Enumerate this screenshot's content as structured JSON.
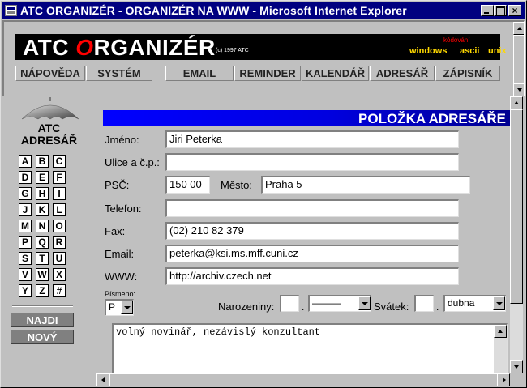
{
  "window": {
    "title": "ATC ORGANIZÉR - ORGANIZÉR NA WWW - Microsoft Internet Explorer",
    "close_glyph": "×"
  },
  "banner": {
    "title_prefix": "ATC ",
    "title_red": "O",
    "title_suffix": "RGANIZÉR",
    "copyright": "(c) 1997 ATC",
    "encoding_label": "kódování",
    "encodings": [
      "windows",
      "ascii",
      "unix"
    ]
  },
  "nav": [
    "NÁPOVĚDA",
    "SYSTÉM",
    "EMAIL",
    "REMINDER",
    "KALENDÁŘ",
    "ADRESÁŘ",
    "ZÁPISNÍK"
  ],
  "sidebar": {
    "logo_line1": "ATC",
    "logo_line2": "ADRESÁŘ",
    "letters": [
      "A",
      "B",
      "C",
      "D",
      "E",
      "F",
      "G",
      "H",
      "I",
      "J",
      "K",
      "L",
      "M",
      "N",
      "O",
      "P",
      "Q",
      "R",
      "S",
      "T",
      "U",
      "V",
      "W",
      "X",
      "Y",
      "Z",
      "#"
    ],
    "search_button": "NAJDI",
    "new_button": "NOVÝ"
  },
  "form": {
    "header": "POLOŽKA ADRESÁŘE",
    "labels": {
      "name": "Jméno:",
      "street": "Ulice a č.p.:",
      "zip": "PSČ:",
      "city": "Město:",
      "phone": "Telefon:",
      "fax": "Fax:",
      "email": "Email:",
      "www": "WWW:",
      "letter": "Písmeno:",
      "birthday": "Narozeniny:",
      "nameday": "Svátek:"
    },
    "values": {
      "name": "Jiri Peterka",
      "street": "",
      "zip": "150 00",
      "city": "Praha 5",
      "phone": "",
      "fax": "(02) 210 82 379",
      "email": "peterka@ksi.ms.mff.cuni.cz",
      "www": "http://archiv.czech.net",
      "letter": "P",
      "birthday_day": "",
      "birthday_month": "———",
      "nameday_day": "",
      "nameday_month": "dubna",
      "note": "volný novinář, nezávislý konzultant"
    },
    "dot": "."
  }
}
